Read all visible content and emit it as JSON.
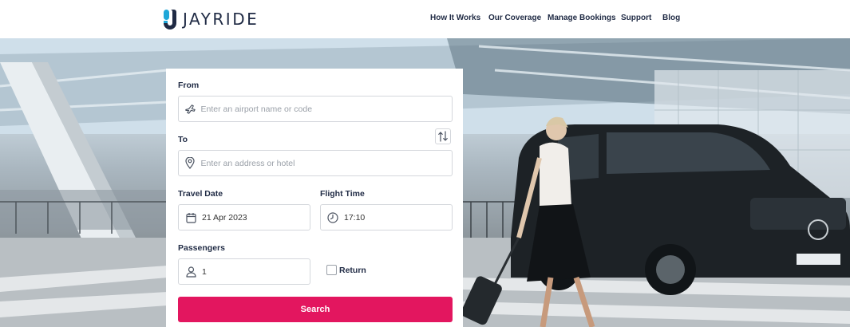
{
  "brand": {
    "name": "JAYRIDE",
    "accent": "#e3165f",
    "logo_color": "#1fa7d8"
  },
  "nav": {
    "items": [
      {
        "label": "How It Works"
      },
      {
        "label": "Our Coverage"
      },
      {
        "label": "Manage Bookings"
      },
      {
        "label": "Support"
      },
      {
        "label": "Blog"
      }
    ]
  },
  "form": {
    "from_label": "From",
    "from_placeholder": "Enter an airport name or code",
    "from_icon": "plane-icon",
    "to_label": "To",
    "to_placeholder": "Enter an address or hotel",
    "to_icon": "location-pin-icon",
    "swap_icon": "swap-arrows-icon",
    "travel_date_label": "Travel Date",
    "travel_date_value": "21 Apr 2023",
    "travel_date_icon": "calendar-icon",
    "flight_time_label": "Flight Time",
    "flight_time_value": "17:10",
    "flight_time_icon": "clock-icon",
    "passengers_label": "Passengers",
    "passengers_value": "1",
    "passengers_icon": "user-icon",
    "return_label": "Return",
    "return_checked": false,
    "search_label": "Search"
  }
}
